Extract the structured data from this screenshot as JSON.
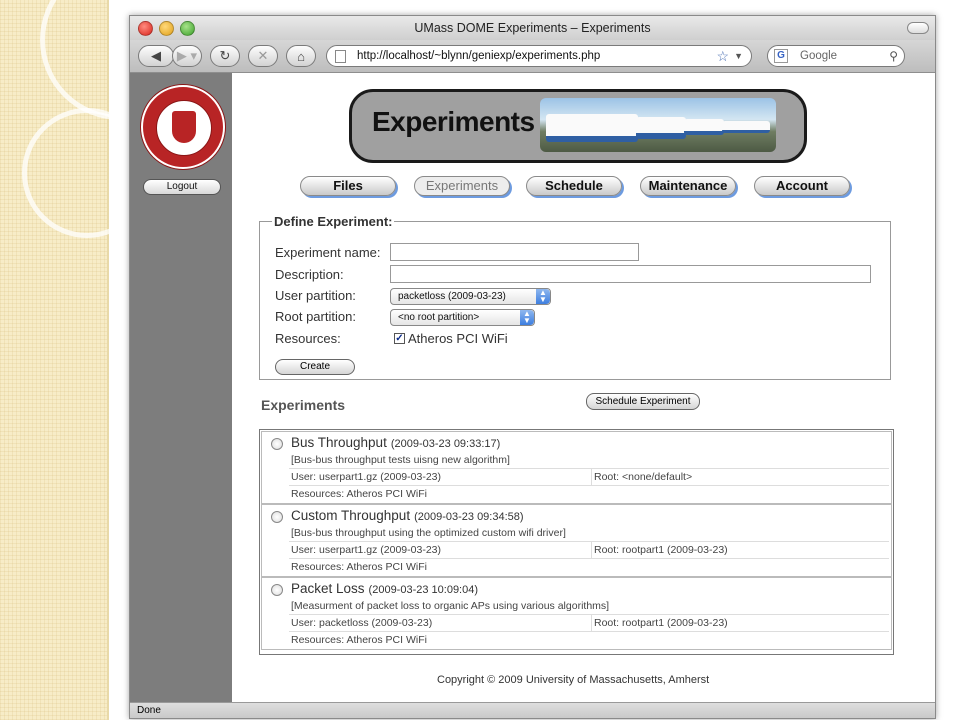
{
  "window": {
    "title": "UMass DOME Experiments – Experiments"
  },
  "toolbar": {
    "url": "http://localhost/~blynn/geniexp/experiments.php",
    "search_placeholder": "Google"
  },
  "sidebar": {
    "logout_label": "Logout",
    "seal_alt": "University of Massachusetts Amherst seal"
  },
  "banner": {
    "title": "Experiments"
  },
  "nav": {
    "items": [
      {
        "label": "Files"
      },
      {
        "label": "Experiments"
      },
      {
        "label": "Schedule"
      },
      {
        "label": "Maintenance"
      },
      {
        "label": "Account"
      }
    ],
    "active_index": 1
  },
  "define": {
    "legend": "Define Experiment:",
    "name_label": "Experiment name:",
    "name_value": "",
    "description_label": "Description:",
    "description_value": "",
    "user_partition_label": "User partition:",
    "user_partition_value": "packetloss  (2009-03-23)",
    "root_partition_label": "Root partition:",
    "root_partition_value": "<no root partition>",
    "resources_label": "Resources:",
    "resource_option": "Atheros PCI WiFi",
    "resource_checked": true,
    "create_label": "Create"
  },
  "experiments": {
    "heading": "Experiments",
    "schedule_label": "Schedule Experiment",
    "items": [
      {
        "name": "Bus Throughput",
        "date": "(2009-03-23 09:33:17)",
        "description": "[Bus-bus throughput tests uisng new algorithm]",
        "user": "User: userpart1.gz  (2009-03-23)",
        "root": "Root: <none/default>",
        "resources": "Resources: Atheros PCI WiFi"
      },
      {
        "name": "Custom Throughput",
        "date": "(2009-03-23 09:34:58)",
        "description": "[Bus-bus throughput using the optimized custom wifi driver]",
        "user": "User: userpart1.gz  (2009-03-23)",
        "root": "Root: rootpart1  (2009-03-23)",
        "resources": "Resources: Atheros PCI WiFi"
      },
      {
        "name": "Packet Loss",
        "date": "(2009-03-23 10:09:04)",
        "description": "[Measurment of packet loss to organic APs using various algorithms]",
        "user": "User: packetloss  (2009-03-23)",
        "root": "Root: rootpart1  (2009-03-23)",
        "resources": "Resources: Atheros PCI WiFi"
      }
    ]
  },
  "footer": {
    "copyright": "Copyright © 2009 University of Massachusetts, Amherst"
  },
  "statusbar": {
    "text": "Done"
  },
  "colors": {
    "sidebar": "#7d7d7d",
    "nav_shadow": "#6d9be0",
    "seal_red": "#b82425"
  }
}
